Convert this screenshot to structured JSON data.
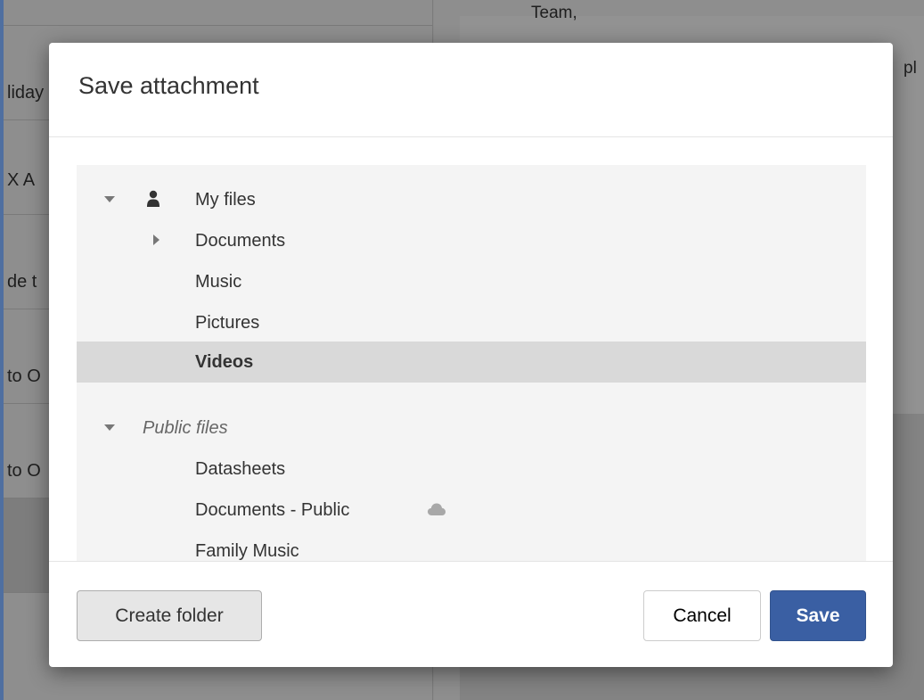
{
  "background": {
    "list_items": [
      "liday",
      "X A",
      "de t",
      "to O",
      "to O"
    ],
    "reader_line_1": "Team,",
    "reader_line_2": "pl"
  },
  "modal": {
    "title": "Save attachment",
    "tree": {
      "my_files": {
        "label": "My files",
        "icon": "user-icon",
        "children": [
          {
            "label": "Documents",
            "expandable": true
          },
          {
            "label": "Music"
          },
          {
            "label": "Pictures"
          },
          {
            "label": "Videos",
            "selected": true
          }
        ]
      },
      "public_files": {
        "label": "Public files",
        "children": [
          {
            "label": "Datasheets"
          },
          {
            "label": "Documents - Public",
            "icon": "cloud-icon"
          },
          {
            "label": "Family Music"
          }
        ]
      }
    },
    "buttons": {
      "create_folder": "Create folder",
      "cancel": "Cancel",
      "save": "Save"
    }
  },
  "colors": {
    "primary": "#3a5fa3",
    "selected_row": "#d9d9d9",
    "tree_bg": "#f4f4f4"
  }
}
